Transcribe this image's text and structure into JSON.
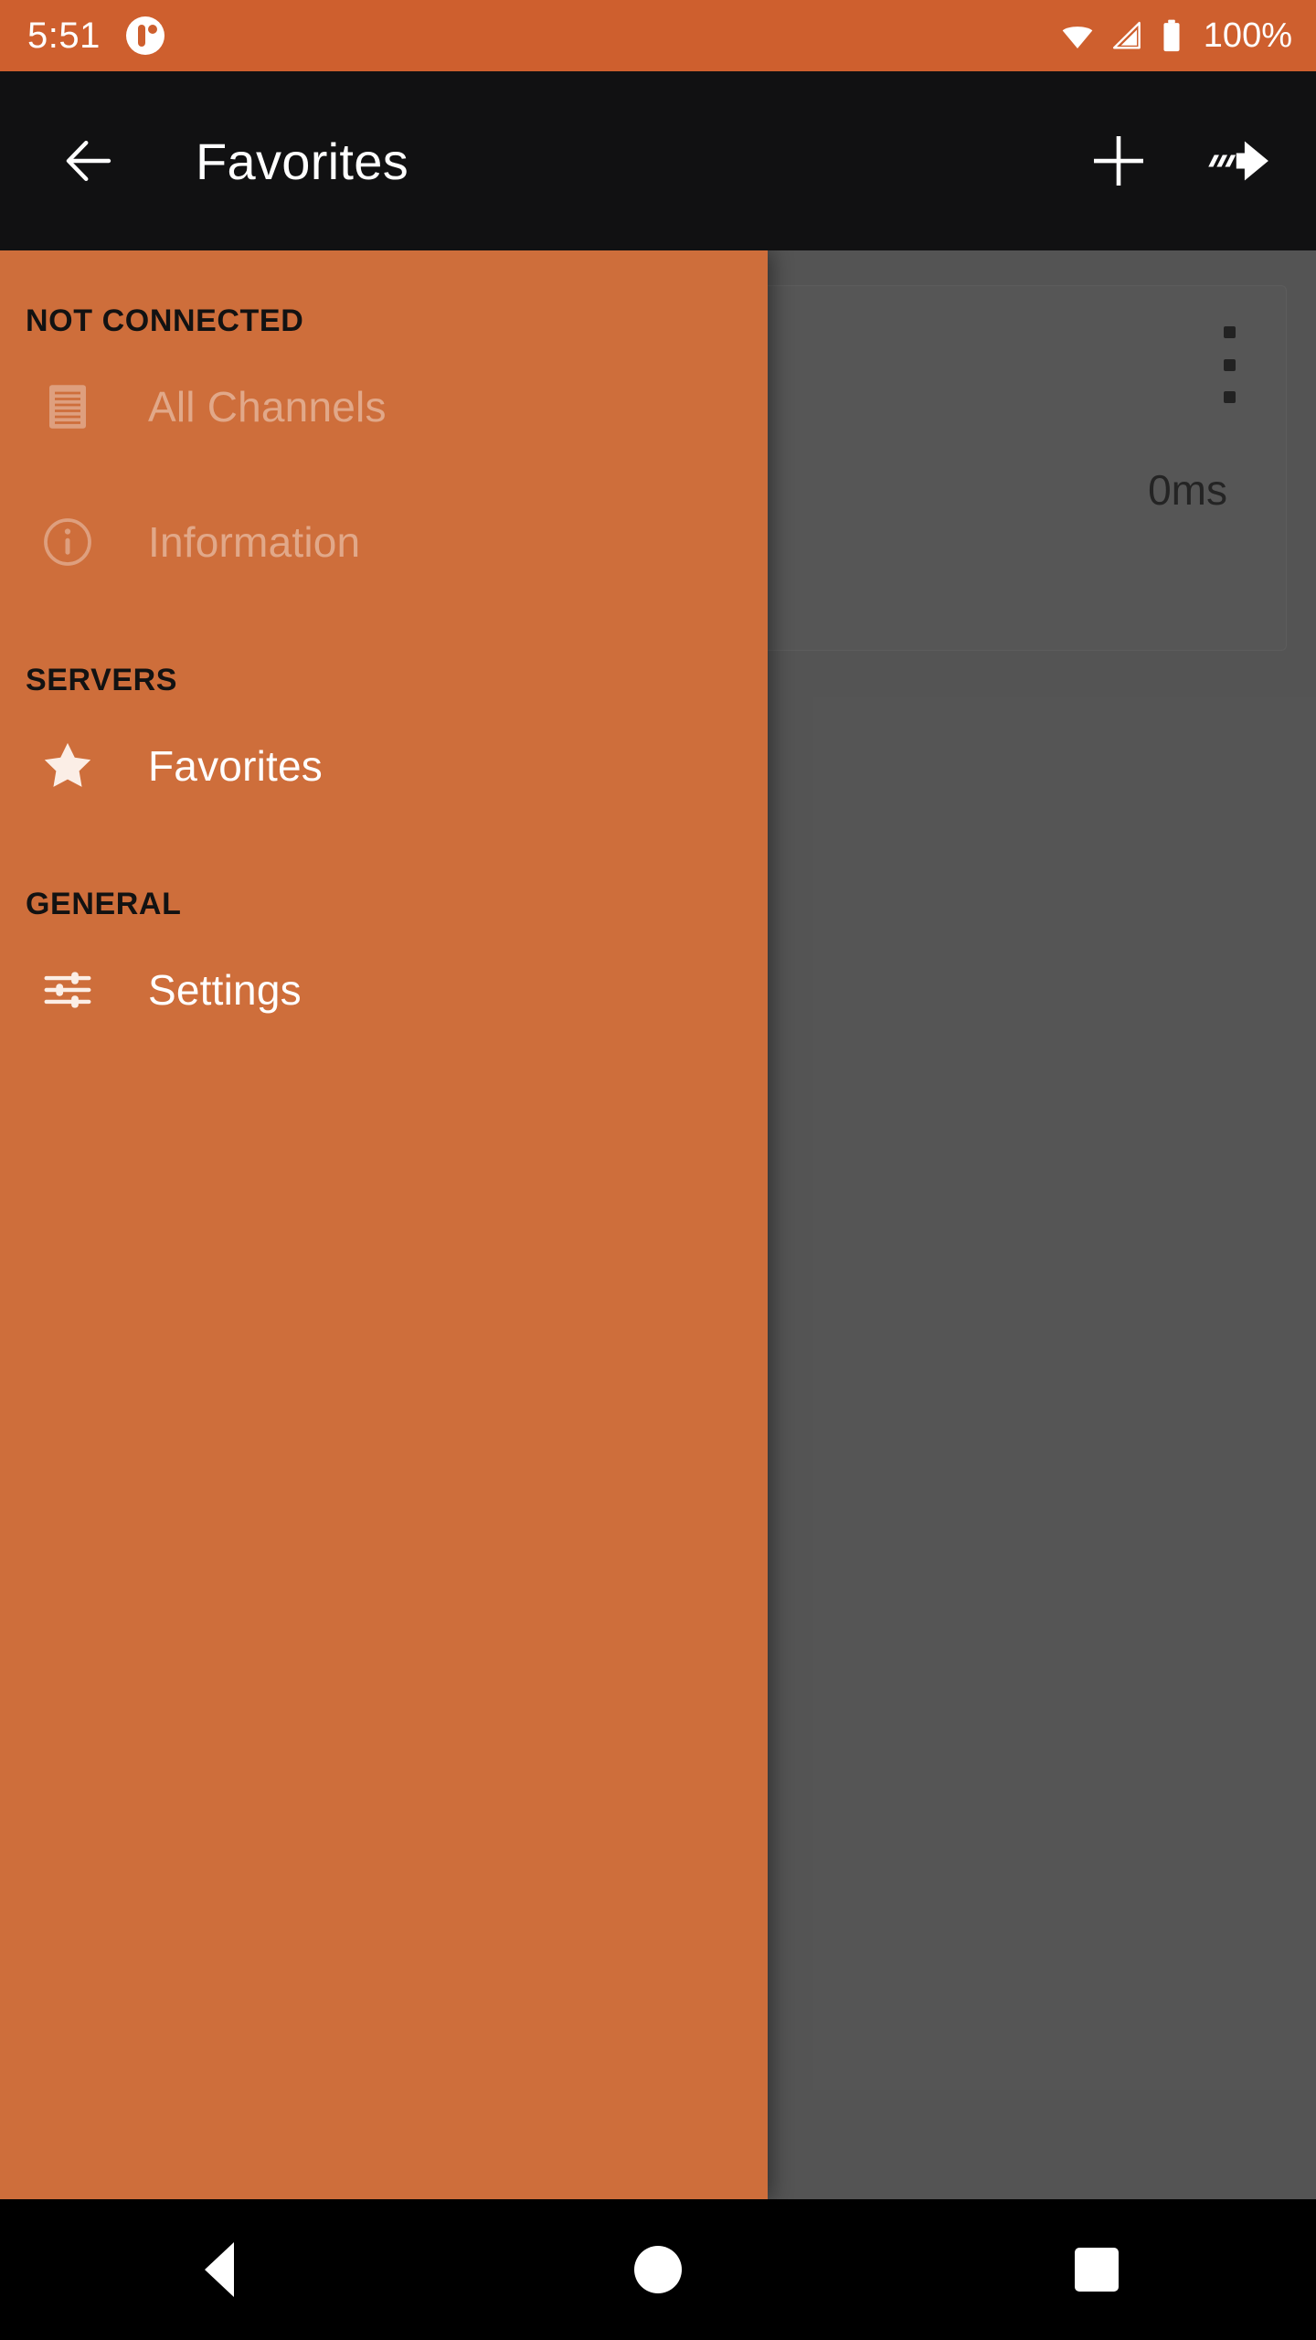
{
  "status_bar": {
    "clock": "5:51",
    "battery_label": "100%",
    "icons": {
      "notification": "mumble-app-icon",
      "wifi": "wifi-icon",
      "cellular": "cellular-signal-icon",
      "battery": "battery-full-icon"
    },
    "background_color": "#CE5F2E"
  },
  "app_bar": {
    "back_icon": "back-arrow-icon",
    "title": "Favorites",
    "actions": [
      {
        "icon": "plus-icon",
        "name": "add-favorite-button"
      },
      {
        "icon": "fast-connect-arrow-icon",
        "name": "connect-button"
      }
    ],
    "background_color": "#111112"
  },
  "drawer": {
    "background_color": "#CE6E3B",
    "sections": [
      {
        "title": "NOT CONNECTED",
        "items": [
          {
            "label": "All Channels",
            "icon": "channel-list-icon",
            "enabled": false
          },
          {
            "label": "Information",
            "icon": "info-circle-icon",
            "enabled": false
          }
        ]
      },
      {
        "title": "SERVERS",
        "items": [
          {
            "label": "Favorites",
            "icon": "star-icon",
            "enabled": true
          }
        ]
      },
      {
        "title": "GENERAL",
        "items": [
          {
            "label": "Settings",
            "icon": "tune-sliders-icon",
            "enabled": true
          }
        ]
      }
    ]
  },
  "content": {
    "server_card": {
      "latency": "0ms",
      "overflow_icon": "more-vert-icon"
    }
  },
  "nav_bar": {
    "back": "nav-back-triangle-icon",
    "home": "nav-home-circle-icon",
    "recents": "nav-recents-square-icon"
  }
}
